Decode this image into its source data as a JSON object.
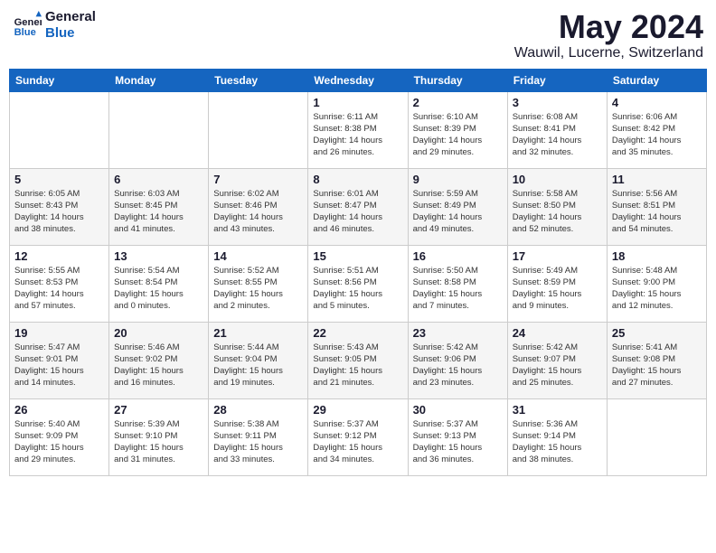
{
  "header": {
    "logo_line1": "General",
    "logo_line2": "Blue",
    "month": "May 2024",
    "location": "Wauwil, Lucerne, Switzerland"
  },
  "days_of_week": [
    "Sunday",
    "Monday",
    "Tuesday",
    "Wednesday",
    "Thursday",
    "Friday",
    "Saturday"
  ],
  "weeks": [
    [
      {
        "day": "",
        "info": ""
      },
      {
        "day": "",
        "info": ""
      },
      {
        "day": "",
        "info": ""
      },
      {
        "day": "1",
        "info": "Sunrise: 6:11 AM\nSunset: 8:38 PM\nDaylight: 14 hours\nand 26 minutes."
      },
      {
        "day": "2",
        "info": "Sunrise: 6:10 AM\nSunset: 8:39 PM\nDaylight: 14 hours\nand 29 minutes."
      },
      {
        "day": "3",
        "info": "Sunrise: 6:08 AM\nSunset: 8:41 PM\nDaylight: 14 hours\nand 32 minutes."
      },
      {
        "day": "4",
        "info": "Sunrise: 6:06 AM\nSunset: 8:42 PM\nDaylight: 14 hours\nand 35 minutes."
      }
    ],
    [
      {
        "day": "5",
        "info": "Sunrise: 6:05 AM\nSunset: 8:43 PM\nDaylight: 14 hours\nand 38 minutes."
      },
      {
        "day": "6",
        "info": "Sunrise: 6:03 AM\nSunset: 8:45 PM\nDaylight: 14 hours\nand 41 minutes."
      },
      {
        "day": "7",
        "info": "Sunrise: 6:02 AM\nSunset: 8:46 PM\nDaylight: 14 hours\nand 43 minutes."
      },
      {
        "day": "8",
        "info": "Sunrise: 6:01 AM\nSunset: 8:47 PM\nDaylight: 14 hours\nand 46 minutes."
      },
      {
        "day": "9",
        "info": "Sunrise: 5:59 AM\nSunset: 8:49 PM\nDaylight: 14 hours\nand 49 minutes."
      },
      {
        "day": "10",
        "info": "Sunrise: 5:58 AM\nSunset: 8:50 PM\nDaylight: 14 hours\nand 52 minutes."
      },
      {
        "day": "11",
        "info": "Sunrise: 5:56 AM\nSunset: 8:51 PM\nDaylight: 14 hours\nand 54 minutes."
      }
    ],
    [
      {
        "day": "12",
        "info": "Sunrise: 5:55 AM\nSunset: 8:53 PM\nDaylight: 14 hours\nand 57 minutes."
      },
      {
        "day": "13",
        "info": "Sunrise: 5:54 AM\nSunset: 8:54 PM\nDaylight: 15 hours\nand 0 minutes."
      },
      {
        "day": "14",
        "info": "Sunrise: 5:52 AM\nSunset: 8:55 PM\nDaylight: 15 hours\nand 2 minutes."
      },
      {
        "day": "15",
        "info": "Sunrise: 5:51 AM\nSunset: 8:56 PM\nDaylight: 15 hours\nand 5 minutes."
      },
      {
        "day": "16",
        "info": "Sunrise: 5:50 AM\nSunset: 8:58 PM\nDaylight: 15 hours\nand 7 minutes."
      },
      {
        "day": "17",
        "info": "Sunrise: 5:49 AM\nSunset: 8:59 PM\nDaylight: 15 hours\nand 9 minutes."
      },
      {
        "day": "18",
        "info": "Sunrise: 5:48 AM\nSunset: 9:00 PM\nDaylight: 15 hours\nand 12 minutes."
      }
    ],
    [
      {
        "day": "19",
        "info": "Sunrise: 5:47 AM\nSunset: 9:01 PM\nDaylight: 15 hours\nand 14 minutes."
      },
      {
        "day": "20",
        "info": "Sunrise: 5:46 AM\nSunset: 9:02 PM\nDaylight: 15 hours\nand 16 minutes."
      },
      {
        "day": "21",
        "info": "Sunrise: 5:44 AM\nSunset: 9:04 PM\nDaylight: 15 hours\nand 19 minutes."
      },
      {
        "day": "22",
        "info": "Sunrise: 5:43 AM\nSunset: 9:05 PM\nDaylight: 15 hours\nand 21 minutes."
      },
      {
        "day": "23",
        "info": "Sunrise: 5:42 AM\nSunset: 9:06 PM\nDaylight: 15 hours\nand 23 minutes."
      },
      {
        "day": "24",
        "info": "Sunrise: 5:42 AM\nSunset: 9:07 PM\nDaylight: 15 hours\nand 25 minutes."
      },
      {
        "day": "25",
        "info": "Sunrise: 5:41 AM\nSunset: 9:08 PM\nDaylight: 15 hours\nand 27 minutes."
      }
    ],
    [
      {
        "day": "26",
        "info": "Sunrise: 5:40 AM\nSunset: 9:09 PM\nDaylight: 15 hours\nand 29 minutes."
      },
      {
        "day": "27",
        "info": "Sunrise: 5:39 AM\nSunset: 9:10 PM\nDaylight: 15 hours\nand 31 minutes."
      },
      {
        "day": "28",
        "info": "Sunrise: 5:38 AM\nSunset: 9:11 PM\nDaylight: 15 hours\nand 33 minutes."
      },
      {
        "day": "29",
        "info": "Sunrise: 5:37 AM\nSunset: 9:12 PM\nDaylight: 15 hours\nand 34 minutes."
      },
      {
        "day": "30",
        "info": "Sunrise: 5:37 AM\nSunset: 9:13 PM\nDaylight: 15 hours\nand 36 minutes."
      },
      {
        "day": "31",
        "info": "Sunrise: 5:36 AM\nSunset: 9:14 PM\nDaylight: 15 hours\nand 38 minutes."
      },
      {
        "day": "",
        "info": ""
      }
    ]
  ]
}
